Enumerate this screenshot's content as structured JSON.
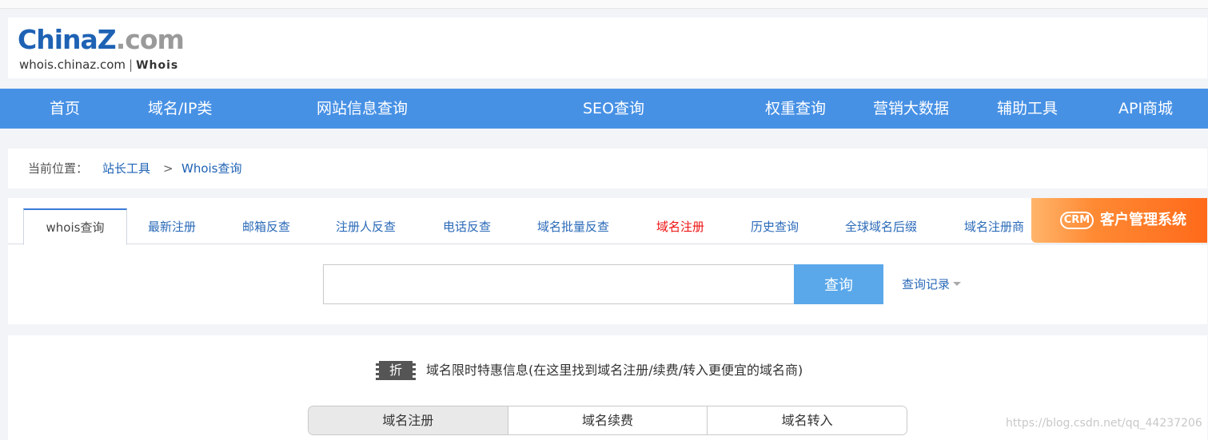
{
  "logo": {
    "brand_part1": "ChinaZ",
    "brand_part2": ".com",
    "subtitle_url": "whois.chinaz.com",
    "separator": "|",
    "subtitle_name": "Whois"
  },
  "nav": {
    "items": [
      "首页",
      "域名/IP类",
      "网站信息查询",
      "SEO查询",
      "权重查询",
      "营销大数据",
      "辅助工具",
      "API商城"
    ]
  },
  "breadcrumb": {
    "label": "当前位置：",
    "items": [
      "站长工具",
      "Whois查询"
    ],
    "separator": ">"
  },
  "tabs": {
    "items": [
      "whois查询",
      "最新注册",
      "邮箱反查",
      "注册人反查",
      "电话反查",
      "域名批量反查",
      "域名注册",
      "历史查询",
      "全球域名后缀",
      "域名注册商"
    ]
  },
  "crm_ad": {
    "badge": "CRM",
    "title": "客户管理系统"
  },
  "search": {
    "value": "",
    "placeholder": "",
    "button_label": "查询",
    "history_label": "查询记录"
  },
  "promo": {
    "badge": "折",
    "text": "域名限时特惠信息(在这里找到域名注册/续费/转入更便宜的域名商)",
    "segments": [
      "域名注册",
      "域名续费",
      "域名转入"
    ]
  },
  "watermark": "https://blog.csdn.net/qq_44237206",
  "colors": {
    "nav_bg": "#4791e5",
    "link": "#2a6ab8",
    "highlight_red": "#ee1111",
    "search_button": "#5aa8ea",
    "crm_orange": "#ff7a25"
  }
}
